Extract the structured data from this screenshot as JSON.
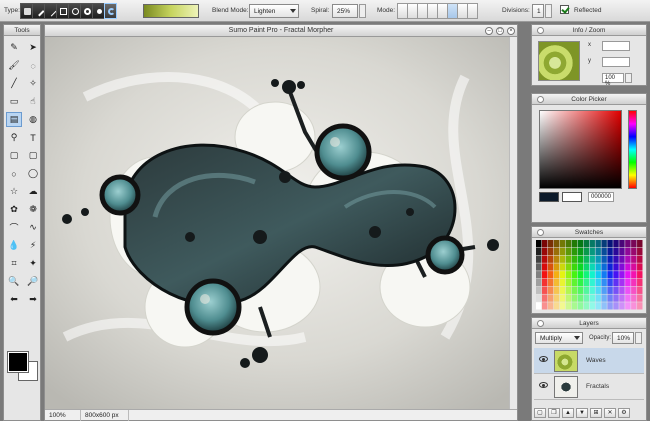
{
  "toolbar": {
    "type_label": "Type:",
    "blend_label": "Blend Mode:",
    "blend_value": "Lighten",
    "spiral_label": "Spiral:",
    "spiral_value": "25%",
    "mode_label": "Mode:",
    "divisions_label": "Divisions:",
    "divisions_value": "1",
    "reflected_label": "Reflected",
    "reflected_checked": true
  },
  "tools_panel": {
    "title": "Tools",
    "icons": [
      "pencil-icon",
      "arrow-icon",
      "brush-icon",
      "lasso-icon",
      "line-icon",
      "airbrush-icon",
      "eraser-icon",
      "smudge-icon",
      "gradient-icon",
      "fill-icon",
      "stamp-icon",
      "text-icon",
      "rectangle-icon",
      "rounded-rect-icon",
      "ellipse-icon",
      "polygon-icon",
      "star-icon",
      "cloud-icon",
      "shape-icon",
      "flower-icon",
      "curve-icon",
      "spline-icon",
      "drop-icon",
      "picker-icon",
      "crop-icon",
      "wand-icon",
      "eyedropper-icon",
      "magnifier-icon",
      "undo-icon",
      "redo-icon"
    ],
    "glyphs": [
      "✎",
      "➤",
      "🖌",
      "◌",
      "╱",
      "✧",
      "▭",
      "☝",
      "▤",
      "◍",
      "⚲",
      "T",
      "▢",
      "▢",
      "○",
      "◯",
      "☆",
      "☁",
      "✿",
      "❁",
      "⌒",
      "∿",
      "💧",
      "⚡",
      "⌗",
      "✦",
      "🔍",
      "🔎",
      "⬅",
      "➡"
    ]
  },
  "canvas": {
    "title": "Sumo Paint Pro - Fractal Morpher",
    "zoom": "100%",
    "size": "800x600 px"
  },
  "info_panel": {
    "title": "Info / Zoom",
    "x_label": "x",
    "y_label": "y",
    "zoom_value": "100 %"
  },
  "color_picker": {
    "title": "Color Picker",
    "hex_value": "000000",
    "primary_color": "#0c1a2a",
    "secondary_color": "#ffffff"
  },
  "swatches_panel": {
    "title": "Swatches"
  },
  "layers_panel": {
    "title": "Layers",
    "blend_value": "Multiply",
    "opacity_label": "Opacity:",
    "opacity_value": "10%",
    "layers": [
      {
        "name": "Waves",
        "selected": true
      },
      {
        "name": "Fractals",
        "selected": false
      }
    ]
  },
  "colors": {
    "accent": "#3d6b6f",
    "panel_bg": "#e6e6e6",
    "workspace_bg": "#7a7a7a"
  }
}
